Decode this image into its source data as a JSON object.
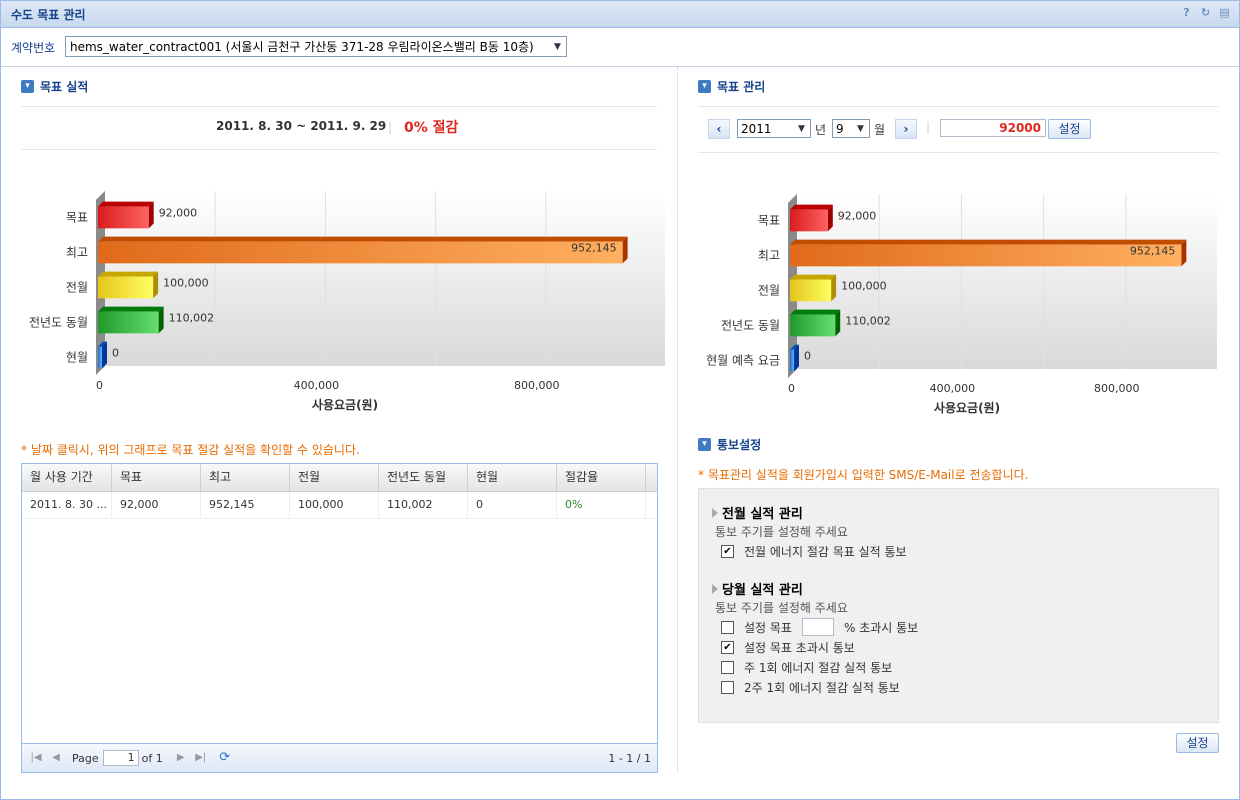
{
  "window": {
    "title": "수도 목표 관리"
  },
  "contract": {
    "label": "계약번호",
    "value": "hems_water_contract001 (서울시 금천구 가산동 371-28 우림라이온스밸리 B동 10층)"
  },
  "left": {
    "section_title": "목표 실적",
    "period": "2011. 8. 30 ~ 2011. 9. 29",
    "saving": "0% 절감",
    "hint": "* 날짜 클릭시, 위의 그래프로 목표 절감 실적을 확인할 수 있습니다.",
    "grid": {
      "columns": [
        "월 사용 기간",
        "목표",
        "최고",
        "전월",
        "전년도 동월",
        "현월",
        "절감율"
      ],
      "rows": [
        [
          "2011. 8. 30 ...",
          "92,000",
          "952,145",
          "100,000",
          "110,002",
          "0",
          "0%"
        ]
      ]
    },
    "pager": {
      "page_label": "Page",
      "page_value": "1",
      "of_label": "of 1",
      "summary": "1 - 1 / 1"
    }
  },
  "right": {
    "section_title": "목표 관리",
    "year": "2011",
    "year_suffix": "년",
    "month": "9",
    "month_suffix": "월",
    "goal_value": "92000",
    "set_label": "설정",
    "noti_title": "통보설정",
    "noti_hint": "* 목표관리 실적을 회원가입시 입력한 SMS/E-Mail로 전송합니다.",
    "prev_group": {
      "title": "전월 실적 관리",
      "sub": "통보 주기를 설정해 주세요",
      "items": [
        {
          "label": "전월 에너지 절감 목표 실적 통보",
          "checked": true
        }
      ]
    },
    "cur_group": {
      "title": "당월 실적 관리",
      "sub": "통보 주기를 설정해 주세요",
      "item0_prefix": "설정 목표",
      "item0_suffix": "% 초과시 통보",
      "items": [
        {
          "label": "설정 목표 초과시 통보",
          "checked": true
        },
        {
          "label": "주 1회 에너지 절감 실적 통보",
          "checked": false
        },
        {
          "label": "2주 1회 에너지 절감 실적 통보",
          "checked": false
        }
      ]
    },
    "bottom_set_label": "설정"
  },
  "chart_data": [
    {
      "type": "bar",
      "orientation": "horizontal",
      "categories": [
        "목표",
        "최고",
        "전월",
        "전년도 동월",
        "현월"
      ],
      "values": [
        92000,
        952145,
        100000,
        110002,
        0
      ],
      "value_labels": [
        "92,000",
        "952,145",
        "100,000",
        "110,002",
        "0"
      ],
      "colors": [
        "#d81c1c",
        "#e06a1a",
        "#e5c51c",
        "#1f9a2a",
        "#1f6ed0"
      ],
      "xlabel": "사용요금(원)",
      "xticks": [
        "0",
        "400,000",
        "800,000"
      ],
      "xlim": [
        0,
        1000000
      ]
    },
    {
      "type": "bar",
      "orientation": "horizontal",
      "categories": [
        "목표",
        "최고",
        "전월",
        "전년도 동월",
        "현월 예측 요금"
      ],
      "values": [
        92000,
        952145,
        100000,
        110002,
        0
      ],
      "value_labels": [
        "92,000",
        "952,145",
        "100,000",
        "110,002",
        "0"
      ],
      "colors": [
        "#d81c1c",
        "#e06a1a",
        "#e5c51c",
        "#1f9a2a",
        "#1f6ed0"
      ],
      "xlabel": "사용요금(원)",
      "xticks": [
        "0",
        "400,000",
        "800,000"
      ],
      "xlim": [
        0,
        1000000
      ]
    }
  ]
}
